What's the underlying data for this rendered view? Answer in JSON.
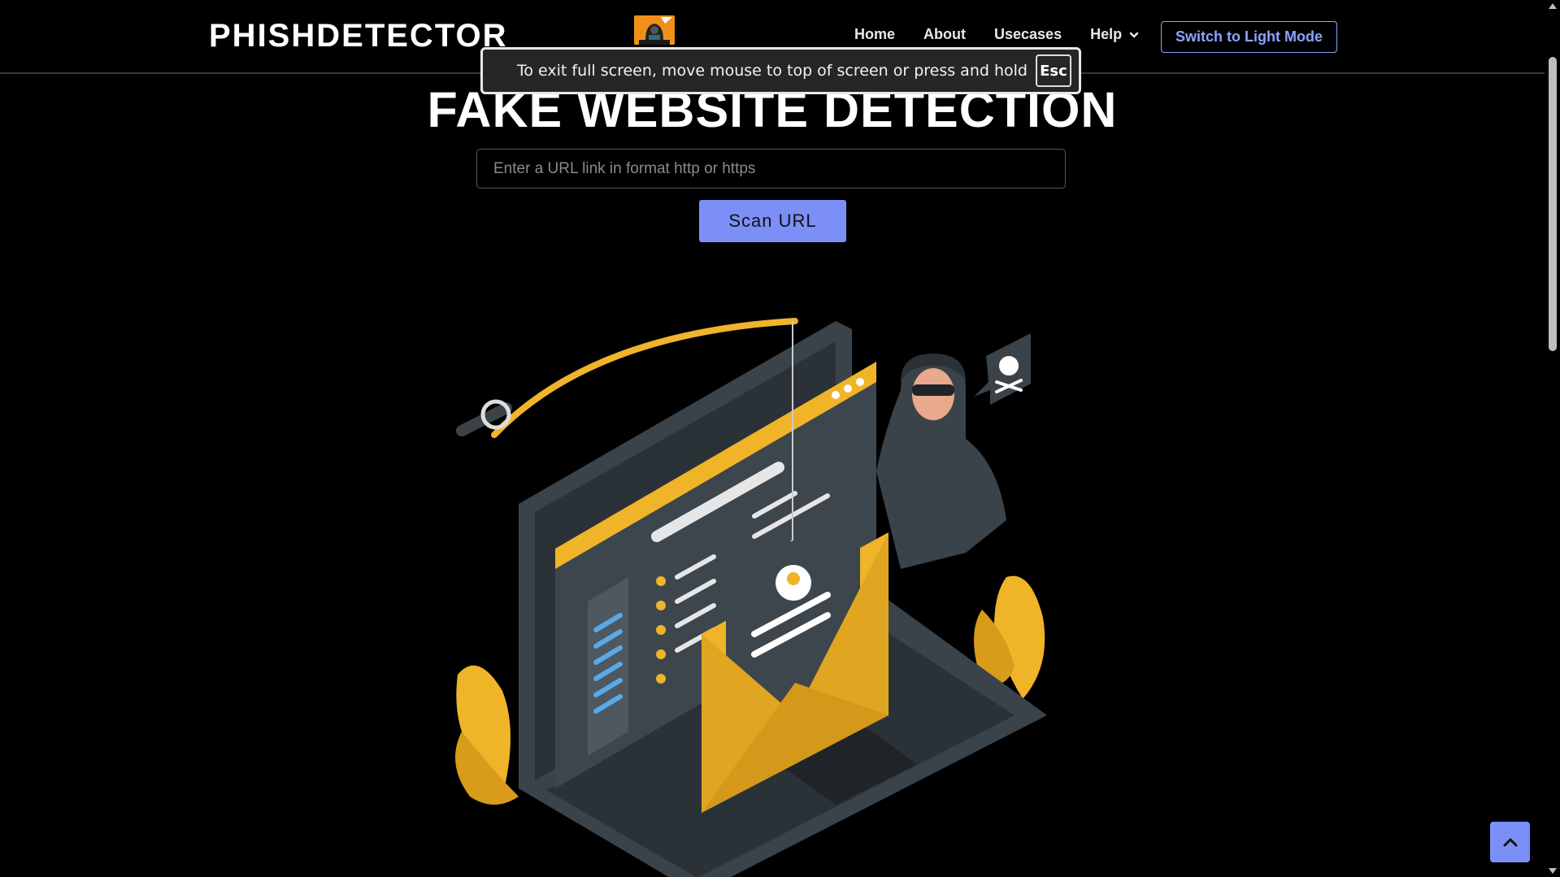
{
  "header": {
    "brand": "PHISHDETECTOR",
    "nav": [
      {
        "label": "Home"
      },
      {
        "label": "About"
      },
      {
        "label": "Usecases"
      },
      {
        "label": "Help"
      }
    ],
    "mode_button": "Switch to Light Mode"
  },
  "fullscreen_notice": {
    "text": "To exit full screen, move mouse to top of screen or press and hold",
    "key": "Esc"
  },
  "main": {
    "title": "FAKE WEBSITE DETECTION",
    "url_input": {
      "value": "",
      "placeholder": "Enter a URL link in format http or https"
    },
    "scan_button": "Scan URL"
  },
  "colors": {
    "accent": "#7b8ff7",
    "illustration_yellow": "#f0b429",
    "background": "#000000"
  },
  "icons": {
    "logo": "hacker-logo-icon",
    "help_chevron": "chevron-down-icon",
    "back_to_top": "chevron-up-icon"
  }
}
